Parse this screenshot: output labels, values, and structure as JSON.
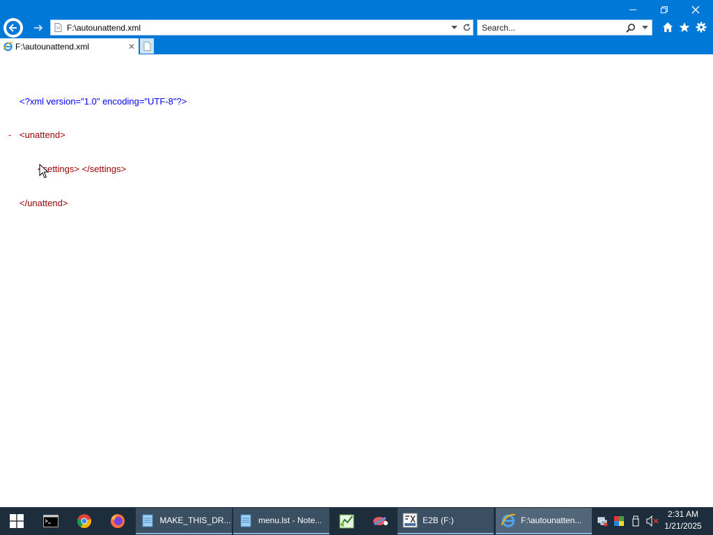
{
  "window": {
    "controls": {
      "minimize_glyph": "—",
      "maximize_glyph": "❐",
      "close_glyph": "✕"
    }
  },
  "navigation": {
    "back_icon": "arrow-left-icon",
    "forward_icon": "arrow-right-icon"
  },
  "address_bar": {
    "url": "F:\\autounattend.xml",
    "page_icon": "document-icon",
    "dropdown_icon": "chevron-down-icon",
    "refresh_icon": "refresh-icon"
  },
  "search": {
    "placeholder": "Search...",
    "search_icon": "magnifier-icon"
  },
  "toolbar": {
    "icons": [
      "home-icon",
      "star-icon",
      "gear-icon"
    ]
  },
  "tabs": [
    {
      "title": "F:\\autounattend.xml",
      "icon": "ie-icon",
      "close_glyph": "✕"
    }
  ],
  "xml_view": {
    "declaration": "<?xml version=\"1.0\" encoding=\"UTF-8\"?>",
    "collapse_marker": "-",
    "root_open": "<unattend>",
    "child": "<settings> </settings>",
    "root_close": "</unattend>"
  },
  "taskbar": {
    "pinned": [
      "start-icon",
      "terminal-icon",
      "chrome-icon",
      "firefox-icon"
    ],
    "apps": [
      {
        "label": "MAKE_THIS_DR...",
        "icon": "notepad-icon"
      },
      {
        "label": "menu.lst - Note...",
        "icon": "notepad-icon"
      },
      {
        "label": "",
        "icon": "chart-app-icon"
      },
      {
        "label": "",
        "icon": "tool-app-icon"
      },
      {
        "label": "E2B (F:)",
        "icon": "e2b-icon"
      },
      {
        "label": "F:\\autounatten...",
        "icon": "ie-icon"
      }
    ],
    "tray_icons": [
      "network-icon",
      "color-icon",
      "usb-icon",
      "volume-muted-icon"
    ],
    "clock": {
      "time": "2:31 AM",
      "date": "1/21/2025"
    }
  },
  "colors": {
    "chrome_blue": "#0078d7",
    "xml_pi": "#0000ff",
    "xml_tag": "#990000",
    "collapse_marker": "#ff0000",
    "taskbar": "#1e2d3c"
  }
}
